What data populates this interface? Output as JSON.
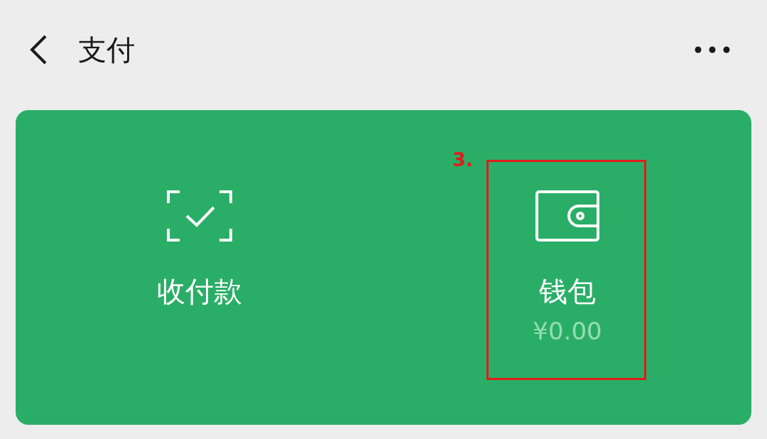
{
  "header": {
    "title": "支付"
  },
  "actions": [
    {
      "kind": "scan",
      "label": "收付款",
      "highlighted": false
    },
    {
      "kind": "wallet",
      "label": "钱包",
      "balance": "¥0.00",
      "highlighted": true,
      "highlight_label": "3."
    }
  ]
}
